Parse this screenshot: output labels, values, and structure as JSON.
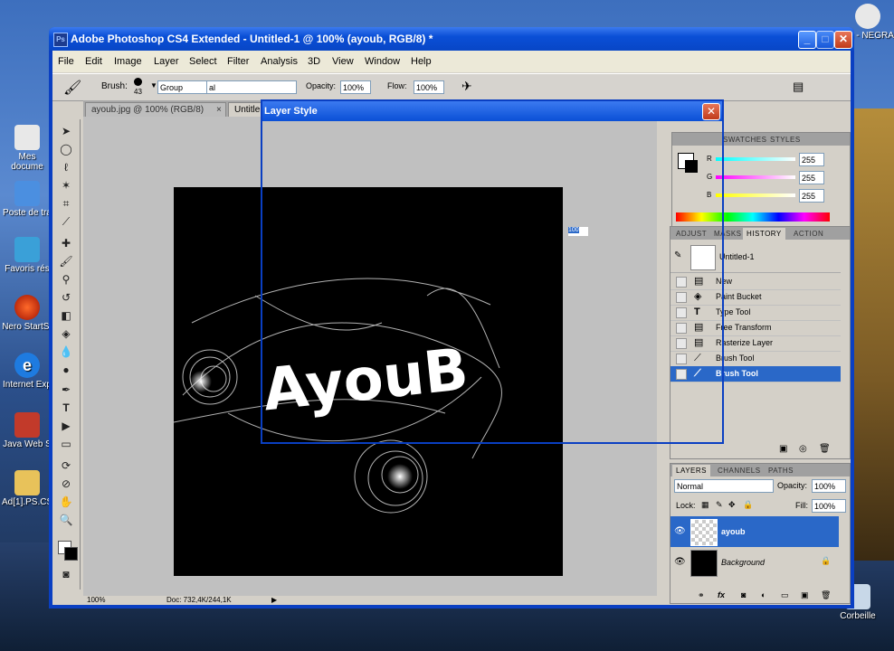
{
  "desktop": {
    "icons": [
      {
        "label": "Mes docume",
        "icon": "documents-icon"
      },
      {
        "label": "Poste de tra",
        "icon": "computer-icon"
      },
      {
        "label": "Favoris rés",
        "icon": "network-icon"
      },
      {
        "label": "Nero StartSr",
        "icon": "nero-icon"
      },
      {
        "label": "Internet Exp",
        "icon": "ie-icon"
      },
      {
        "label": "Java Web S",
        "icon": "java-icon"
      },
      {
        "label": "Ad[1].PS.CS",
        "icon": "folder-icon"
      }
    ],
    "right_icons": [
      {
        "label": "igg - NEGRA",
        "icon": "media-icon"
      },
      {
        "label": "Corbeille",
        "icon": "recycle-bin-icon"
      }
    ]
  },
  "window": {
    "title": "Adobe Photoshop CS4 Extended - Untitled-1 @ 100% (ayoub, RGB/8) *",
    "logo": "Ps",
    "minimize": "_",
    "maximize": "□",
    "close": "✕"
  },
  "menu": [
    "File",
    "Edit",
    "Image",
    "Layer",
    "Select",
    "Filter",
    "Analysis",
    "3D",
    "View",
    "Window",
    "Help"
  ],
  "options": {
    "brush_label": "Brush:",
    "brush_size": "43",
    "mode_value": "Group",
    "mode_value2": "al",
    "opacity_label": "Opacity:",
    "opacity_value": "100%",
    "flow_label": "Flow:",
    "flow_value": "100%"
  },
  "doc_tabs": [
    "ayoub.jpg @ 100% (RGB/8)",
    "Untitle"
  ],
  "canvas": {
    "art_text": "AyouB",
    "stray_value": "100"
  },
  "status": {
    "zoom": "100%",
    "doc": "Doc: 732,4K/244,1K"
  },
  "color_panel": {
    "tabs": [
      "SWATCHES",
      "STYLES"
    ],
    "r_label": "R",
    "g_label": "G",
    "b_label": "B",
    "r": "255",
    "g": "255",
    "b": "255"
  },
  "history_panel": {
    "tabs": [
      "ADJUST",
      "MASKS",
      "HISTORY",
      "ACTION"
    ],
    "snapshot": "Untitled-1",
    "items": [
      {
        "label": "New",
        "icon": "document-icon"
      },
      {
        "label": "Paint Bucket",
        "icon": "paint-bucket-icon"
      },
      {
        "label": "Type Tool",
        "icon": "type-icon"
      },
      {
        "label": "Free Transform",
        "icon": "document-icon"
      },
      {
        "label": "Rasterize Layer",
        "icon": "document-icon"
      },
      {
        "label": "Brush Tool",
        "icon": "brush-icon"
      },
      {
        "label": "Brush Tool",
        "icon": "brush-icon"
      }
    ]
  },
  "layers_panel": {
    "tabs": [
      "LAYERS",
      "CHANNELS",
      "PATHS"
    ],
    "blend": "Normal",
    "opacity_label": "Opacity:",
    "opacity": "100%",
    "lock_label": "Lock:",
    "fill_label": "Fill:",
    "fill": "100%",
    "layers": [
      {
        "name": "ayoub"
      },
      {
        "name": "Background"
      }
    ],
    "footer_fx": "fx"
  },
  "dialog": {
    "title": "Layer Style",
    "close": "✕"
  }
}
